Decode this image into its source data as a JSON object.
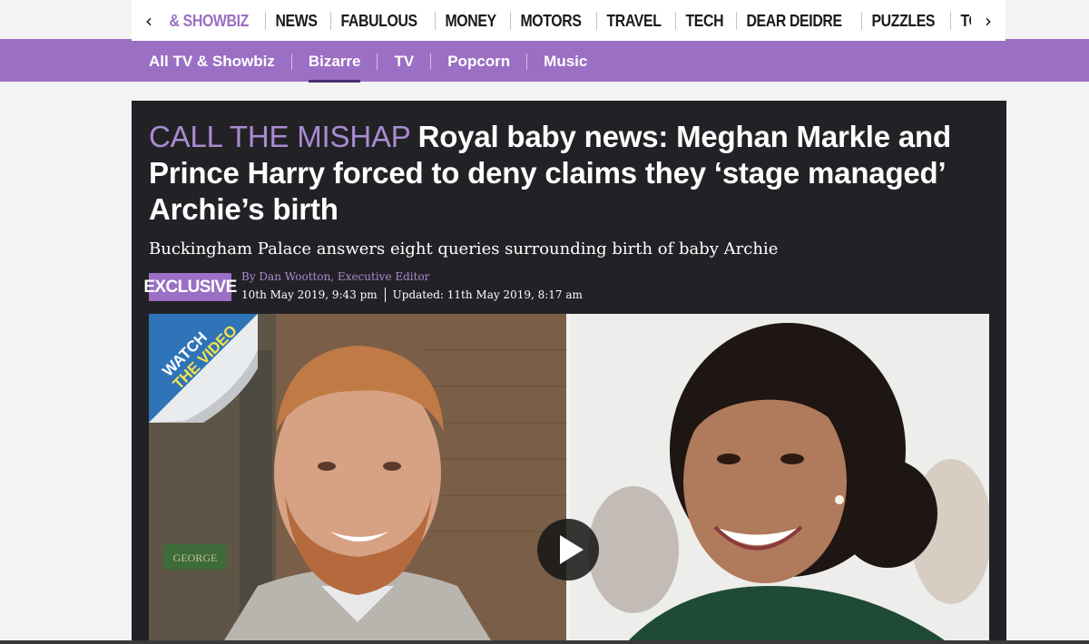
{
  "top_nav": {
    "items": [
      "& SHOWBIZ",
      "NEWS",
      "FABULOUS",
      "MONEY",
      "MOTORS",
      "TRAVEL",
      "TECH",
      "DEAR DEIDRE",
      "PUZZLES",
      "TOP"
    ],
    "prev_icon": "chevron-left-icon",
    "next_icon": "chevron-right-icon"
  },
  "sub_nav": {
    "items": [
      "All TV & Showbiz",
      "Bizarre",
      "TV",
      "Popcorn",
      "Music"
    ],
    "active": "Bizarre"
  },
  "article": {
    "kicker": "CALL THE MISHAP",
    "headline": "Royal baby news: Meghan Markle and Prince Harry forced to deny claims they ‘stage managed’ Archie’s birth",
    "standfirst": "Buckingham Palace answers eight queries surrounding birth of baby Archie",
    "badge": "EXCLUSIVE",
    "byline": "By Dan Wootton, Executive Editor",
    "published": "10th May 2019, 9:43 pm",
    "updated": "Updated: 11th May 2019, 8:17 am"
  },
  "media": {
    "watch_line1": "WATCH",
    "watch_line2": "THE VIDEO",
    "sign_text": "GEORGE",
    "play_icon": "play-icon"
  },
  "colors": {
    "brand_purple": "#9b6fc4",
    "kicker_purple": "#a98bd0",
    "card_bg": "#222226",
    "watch_blue": "#2f74b8",
    "watch_yellow": "#f4e24a"
  }
}
